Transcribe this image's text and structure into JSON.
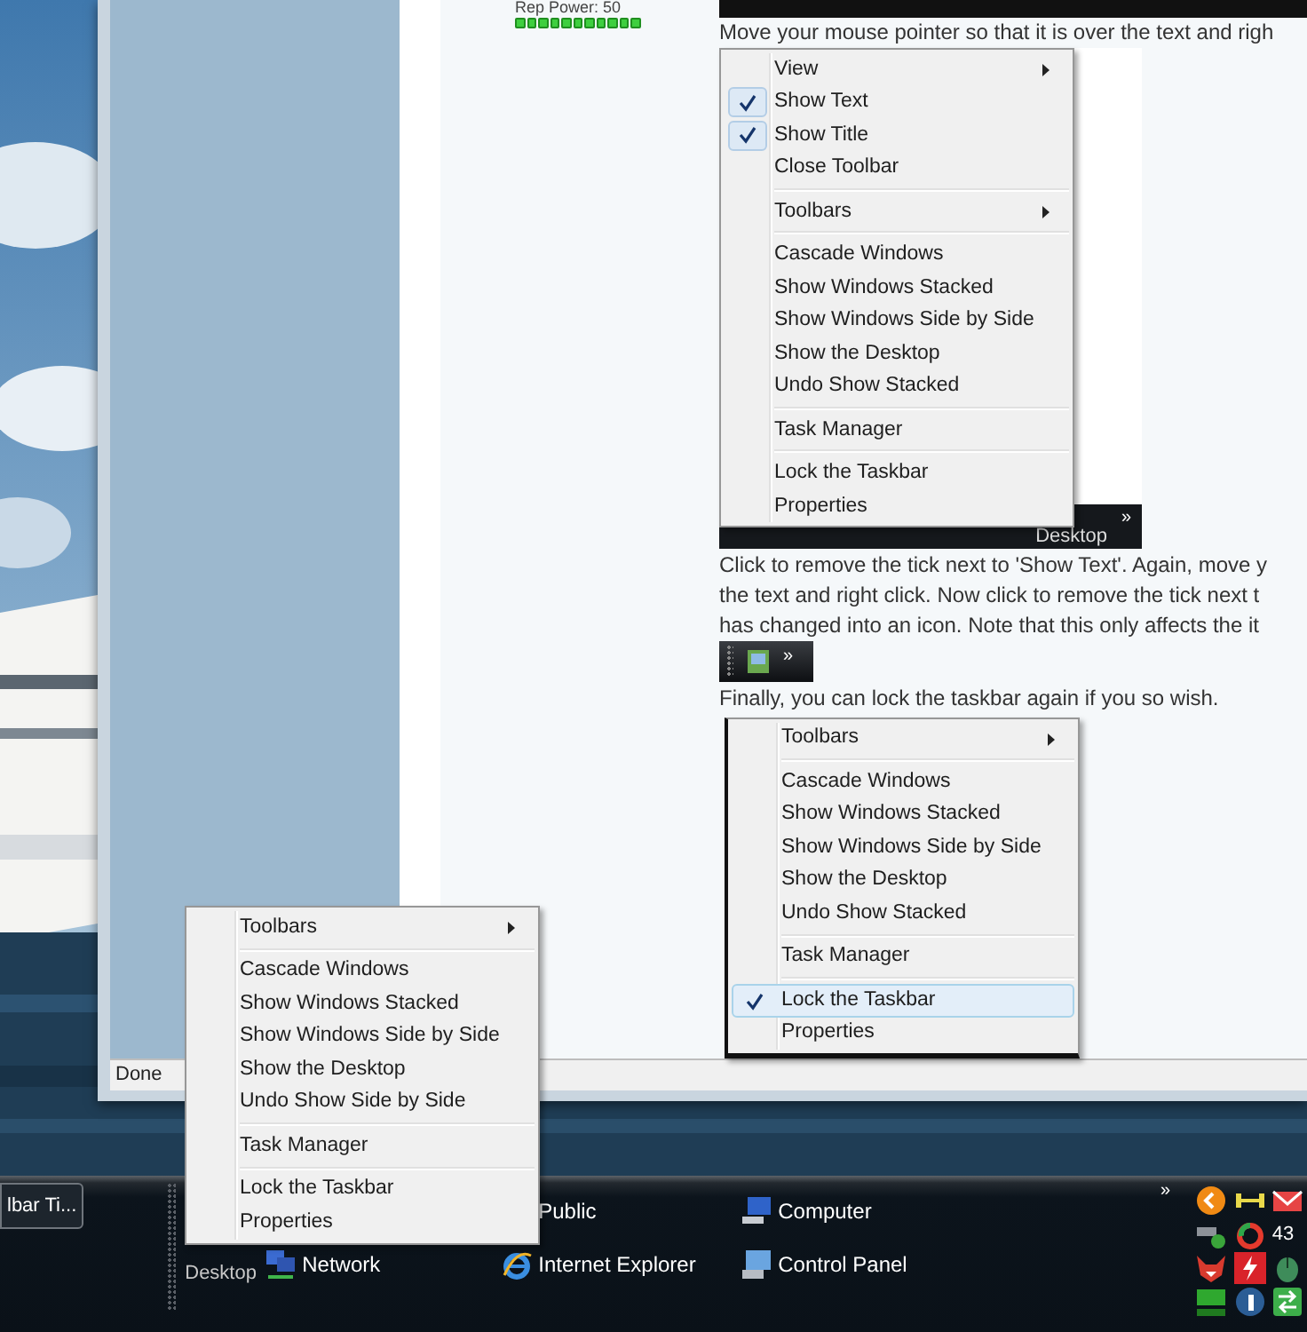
{
  "browser": {
    "status": "Done"
  },
  "post": {
    "rep_power": "Rep Power: 50",
    "intro": "Move your mouse pointer so that it is over the text and righ",
    "screenshot_1": {
      "menu": {
        "groups": [
          [
            {
              "label": "View",
              "checked": false,
              "submenu": true,
              "selected": false
            },
            {
              "label": "Show Text",
              "checked": true,
              "submenu": false,
              "selected": false
            },
            {
              "label": "Show Title",
              "checked": true,
              "submenu": false,
              "selected": false
            },
            {
              "label": "Close Toolbar",
              "checked": false,
              "submenu": false,
              "selected": false
            }
          ],
          [
            {
              "label": "Toolbars",
              "checked": false,
              "submenu": true,
              "selected": false
            }
          ],
          [
            {
              "label": "Cascade Windows",
              "checked": false,
              "submenu": false,
              "selected": false
            },
            {
              "label": "Show Windows Stacked",
              "checked": false,
              "submenu": false,
              "selected": false
            },
            {
              "label": "Show Windows Side by Side",
              "checked": false,
              "submenu": false,
              "selected": false
            },
            {
              "label": "Show the Desktop",
              "checked": false,
              "submenu": false,
              "selected": false
            },
            {
              "label": "Undo Show Stacked",
              "checked": false,
              "submenu": false,
              "selected": false
            }
          ],
          [
            {
              "label": "Task Manager",
              "checked": false,
              "submenu": false,
              "selected": false
            }
          ],
          [
            {
              "label": "Lock the Taskbar",
              "checked": false,
              "submenu": false,
              "selected": false
            },
            {
              "label": "Properties",
              "checked": false,
              "submenu": false,
              "selected": false
            }
          ]
        ]
      },
      "taskbar_label": "Desktop",
      "chevron": "»"
    },
    "paragraph_lines": [
      "Click to remove the tick next to 'Show Text'. Again, move y",
      "the text and right click. Now click to remove the tick next t",
      "has changed into an icon. Note that this only affects the it"
    ],
    "screenshot_2": {
      "chevron": "»"
    },
    "outro": "Finally, you can lock the taskbar again if you so wish.",
    "screenshot_3": {
      "menu": {
        "groups": [
          [
            {
              "label": "Toolbars",
              "checked": false,
              "submenu": true,
              "selected": false
            }
          ],
          [
            {
              "label": "Cascade Windows",
              "checked": false,
              "submenu": false,
              "selected": false
            },
            {
              "label": "Show Windows Stacked",
              "checked": false,
              "submenu": false,
              "selected": false
            },
            {
              "label": "Show Windows Side by Side",
              "checked": false,
              "submenu": false,
              "selected": false
            },
            {
              "label": "Show the Desktop",
              "checked": false,
              "submenu": false,
              "selected": false
            },
            {
              "label": "Undo Show Stacked",
              "checked": false,
              "submenu": false,
              "selected": false
            }
          ],
          [
            {
              "label": "Task Manager",
              "checked": false,
              "submenu": false,
              "selected": false
            }
          ],
          [
            {
              "label": "Lock the Taskbar",
              "checked": true,
              "submenu": false,
              "selected": true
            },
            {
              "label": "Properties",
              "checked": false,
              "submenu": false,
              "selected": false
            }
          ]
        ]
      }
    }
  },
  "context_menu": {
    "groups": [
      [
        {
          "label": "Toolbars",
          "checked": false,
          "submenu": true,
          "selected": false
        }
      ],
      [
        {
          "label": "Cascade Windows",
          "checked": false,
          "submenu": false,
          "selected": false
        },
        {
          "label": "Show Windows Stacked",
          "checked": false,
          "submenu": false,
          "selected": false
        },
        {
          "label": "Show Windows Side by Side",
          "checked": false,
          "submenu": false,
          "selected": false
        },
        {
          "label": "Show the Desktop",
          "checked": false,
          "submenu": false,
          "selected": false
        },
        {
          "label": "Undo Show Side by Side",
          "checked": false,
          "submenu": false,
          "selected": false
        }
      ],
      [
        {
          "label": "Task Manager",
          "checked": false,
          "submenu": false,
          "selected": false
        }
      ],
      [
        {
          "label": "Lock the Taskbar",
          "checked": false,
          "submenu": false,
          "selected": false
        },
        {
          "label": "Properties",
          "checked": false,
          "submenu": false,
          "selected": false
        }
      ]
    ]
  },
  "taskbar": {
    "button": "lbar Ti...",
    "toolbar_label": "Desktop",
    "shortcuts": [
      {
        "label": "Public"
      },
      {
        "label": "Computer",
        "kind": "computer"
      },
      {
        "label": "Network",
        "kind": "network"
      },
      {
        "label": "Internet Explorer",
        "kind": "browser"
      },
      {
        "label": "Control Panel",
        "kind": "control_panel"
      }
    ],
    "chevron": "»",
    "tray_text": "43"
  }
}
